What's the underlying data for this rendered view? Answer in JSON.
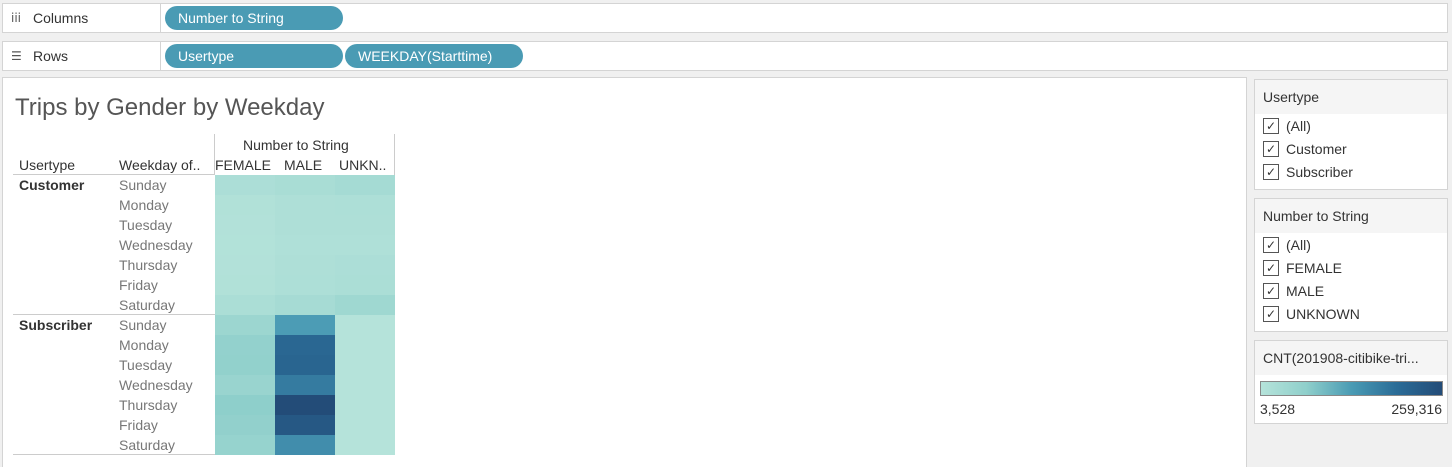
{
  "shelves": {
    "columns_label": "Columns",
    "columns_pills": [
      "Number to String"
    ],
    "rows_label": "Rows",
    "rows_pills": [
      "Usertype",
      "WEEKDAY(Starttime)"
    ]
  },
  "viz": {
    "title": "Trips by Gender by Weekday",
    "header_group": "Number to String",
    "col_header_usertype": "Usertype",
    "col_header_weekday": "Weekday of..",
    "columns": [
      "FEMALE",
      "MALE",
      "UNKN.."
    ],
    "usertypes": [
      "Customer",
      "Subscriber"
    ],
    "weekdays": [
      "Sunday",
      "Monday",
      "Tuesday",
      "Wednesday",
      "Thursday",
      "Friday",
      "Saturday"
    ]
  },
  "chart_data": {
    "type": "heatmap",
    "title": "Trips by Gender by Weekday",
    "rows": [
      {
        "usertype": "Customer",
        "weekday": "Sunday",
        "values": {
          "FEMALE": 18000,
          "MALE": 24000,
          "UNKNOWN": 30000
        }
      },
      {
        "usertype": "Customer",
        "weekday": "Monday",
        "values": {
          "FEMALE": 10000,
          "MALE": 16000,
          "UNKNOWN": 17000
        }
      },
      {
        "usertype": "Customer",
        "weekday": "Tuesday",
        "values": {
          "FEMALE": 9000,
          "MALE": 15000,
          "UNKNOWN": 16000
        }
      },
      {
        "usertype": "Customer",
        "weekday": "Wednesday",
        "values": {
          "FEMALE": 8000,
          "MALE": 14000,
          "UNKNOWN": 14000
        }
      },
      {
        "usertype": "Customer",
        "weekday": "Thursday",
        "values": {
          "FEMALE": 9000,
          "MALE": 16000,
          "UNKNOWN": 18000
        }
      },
      {
        "usertype": "Customer",
        "weekday": "Friday",
        "values": {
          "FEMALE": 10000,
          "MALE": 17000,
          "UNKNOWN": 20000
        }
      },
      {
        "usertype": "Customer",
        "weekday": "Saturday",
        "values": {
          "FEMALE": 20000,
          "MALE": 28000,
          "UNKNOWN": 40000
        }
      },
      {
        "usertype": "Subscriber",
        "weekday": "Sunday",
        "values": {
          "FEMALE": 45000,
          "MALE": 130000,
          "UNKNOWN": 4000
        }
      },
      {
        "usertype": "Subscriber",
        "weekday": "Monday",
        "values": {
          "FEMALE": 60000,
          "MALE": 205000,
          "UNKNOWN": 3800
        }
      },
      {
        "usertype": "Subscriber",
        "weekday": "Tuesday",
        "values": {
          "FEMALE": 62000,
          "MALE": 210000,
          "UNKNOWN": 3700
        }
      },
      {
        "usertype": "Subscriber",
        "weekday": "Wednesday",
        "values": {
          "FEMALE": 50000,
          "MALE": 175000,
          "UNKNOWN": 3600
        }
      },
      {
        "usertype": "Subscriber",
        "weekday": "Thursday",
        "values": {
          "FEMALE": 68000,
          "MALE": 259316,
          "UNKNOWN": 3800
        }
      },
      {
        "usertype": "Subscriber",
        "weekday": "Friday",
        "values": {
          "FEMALE": 63000,
          "MALE": 235000,
          "UNKNOWN": 3600
        }
      },
      {
        "usertype": "Subscriber",
        "weekday": "Saturday",
        "values": {
          "FEMALE": 56000,
          "MALE": 150000,
          "UNKNOWN": 3528
        }
      }
    ],
    "columns": [
      "FEMALE",
      "MALE",
      "UNKNOWN"
    ],
    "color_range": [
      3528,
      259316
    ],
    "color_low": "#b5e3da",
    "color_high": "#234c78"
  },
  "filters": [
    {
      "title": "Usertype",
      "items": [
        "(All)",
        "Customer",
        "Subscriber"
      ]
    },
    {
      "title": "Number to String",
      "items": [
        "(All)",
        "FEMALE",
        "MALE",
        "UNKNOWN"
      ]
    }
  ],
  "legend": {
    "title": "CNT(201908-citibike-tri...",
    "min_label": "3,528",
    "max_label": "259,316"
  },
  "icons": {
    "columns": "columns-icon",
    "rows": "rows-icon",
    "checkbox": "checkmark-icon"
  }
}
